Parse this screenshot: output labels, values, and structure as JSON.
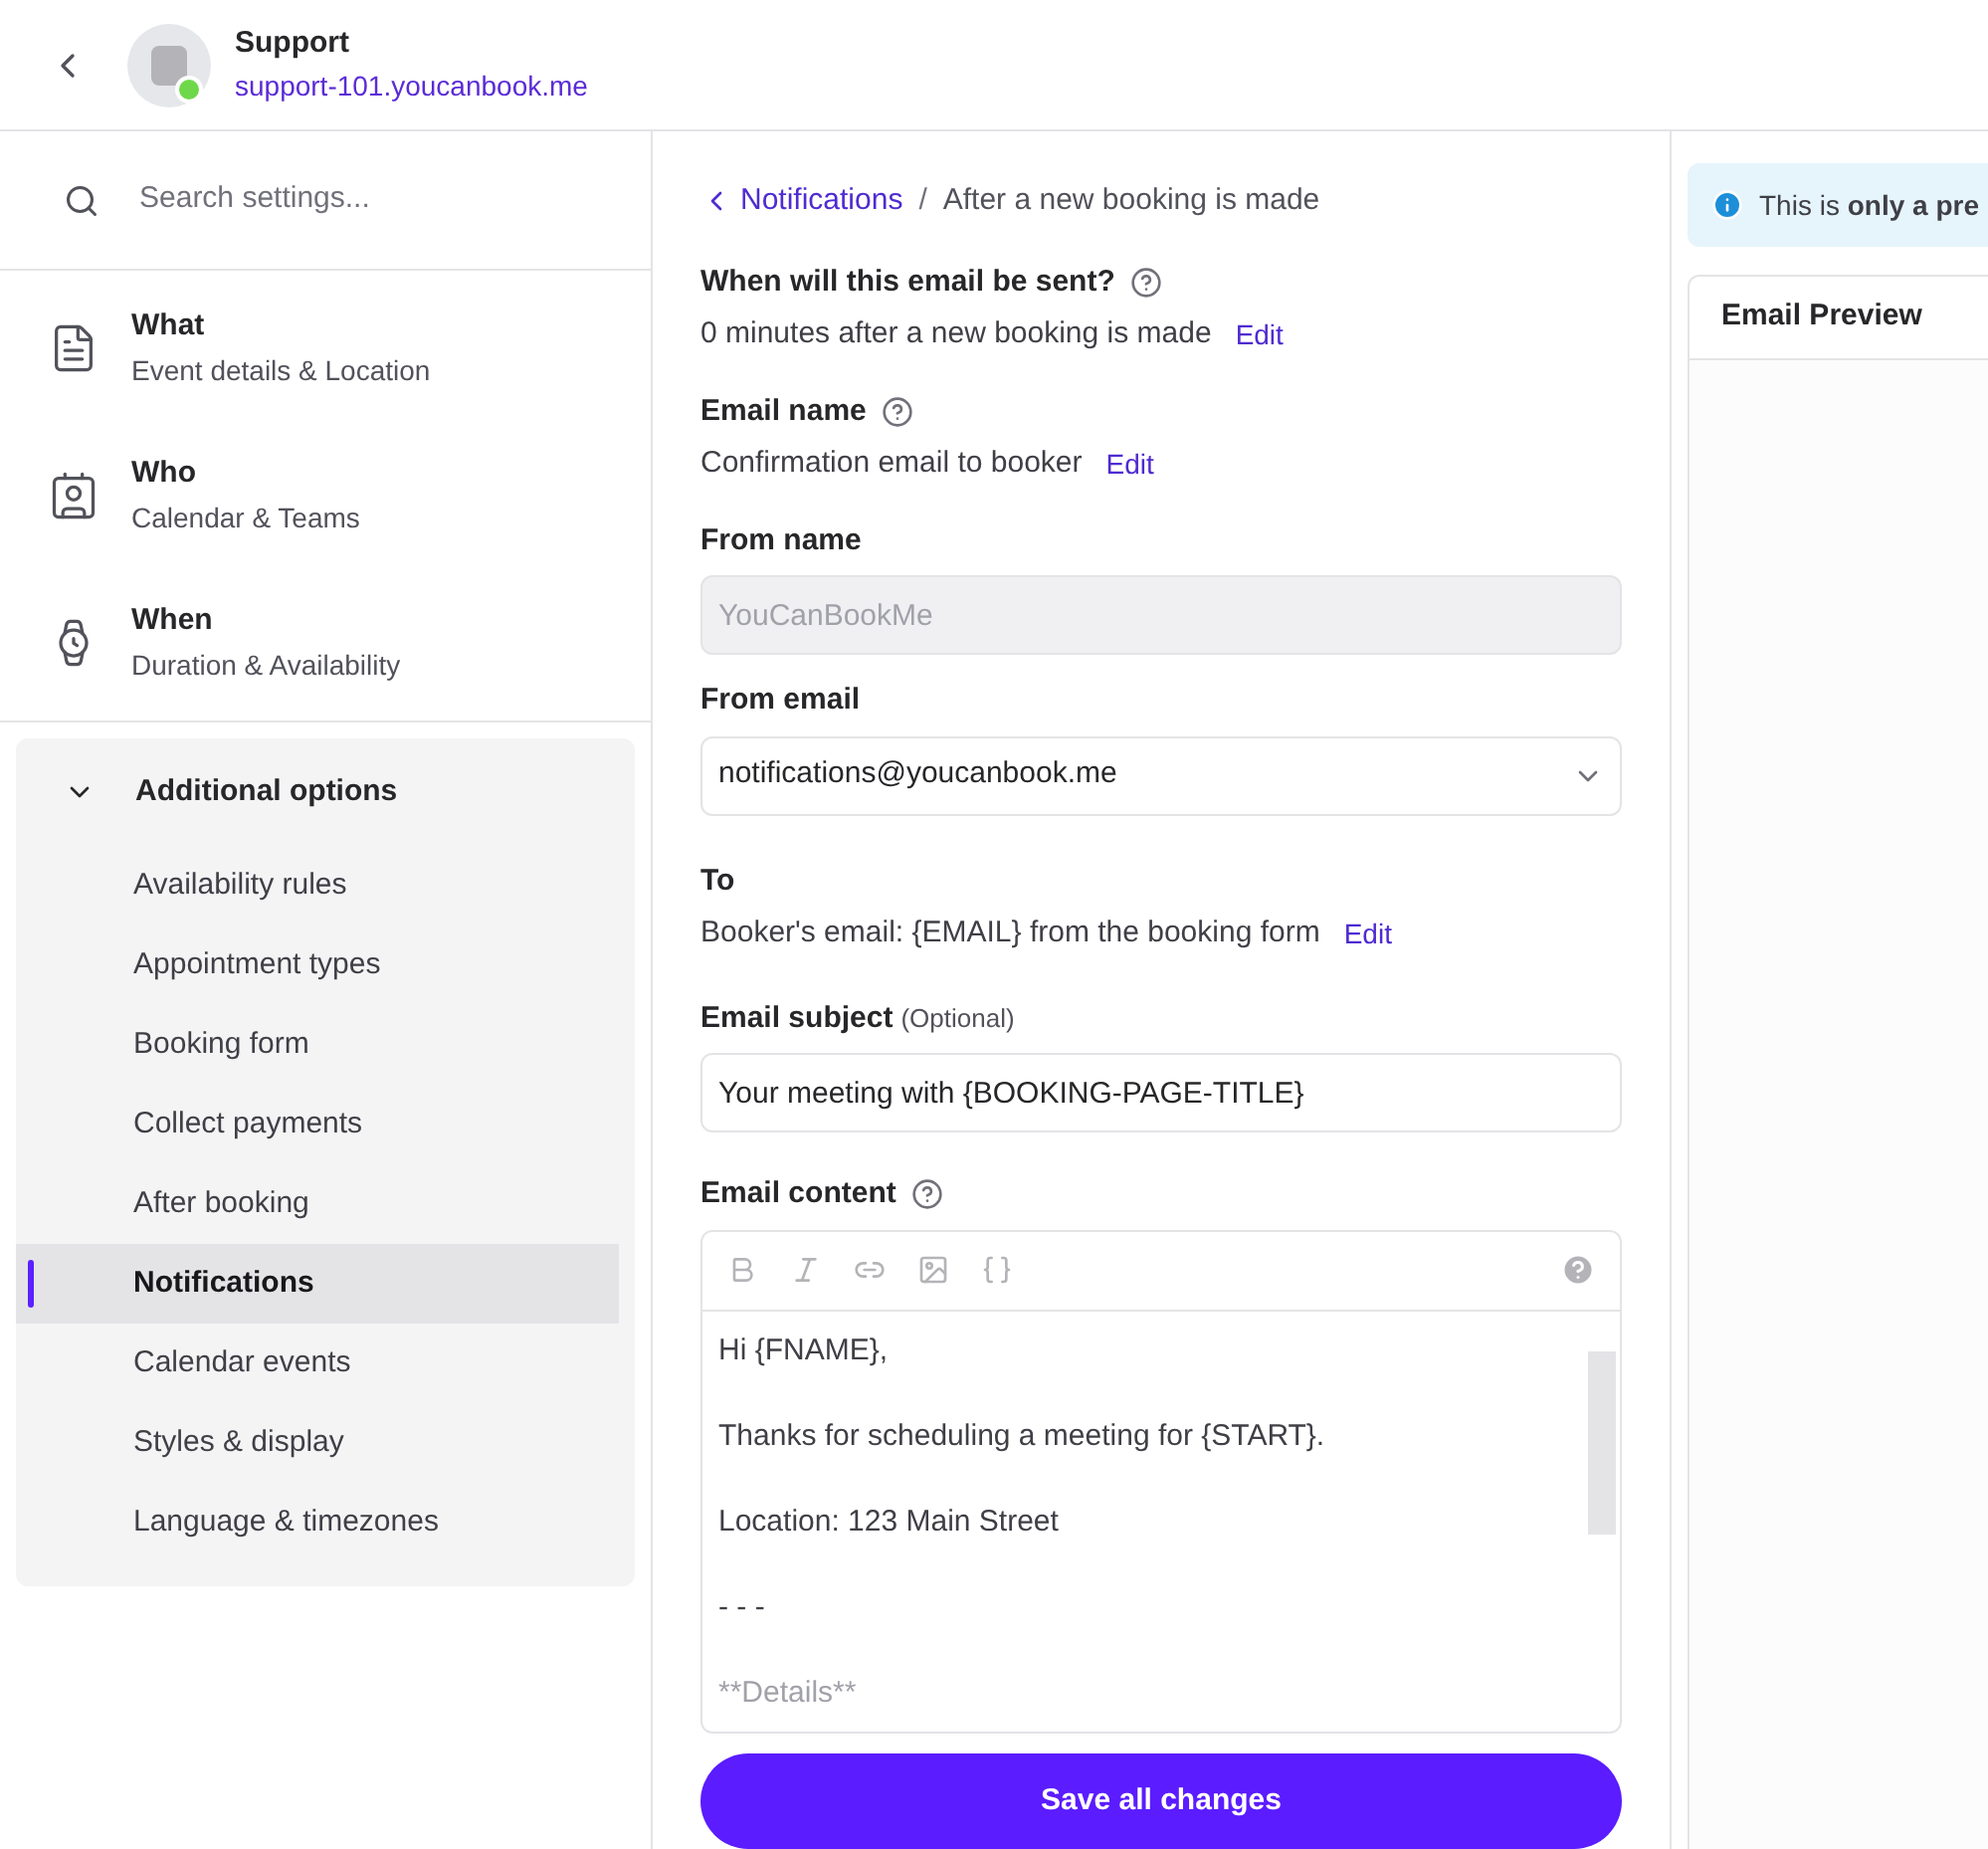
{
  "header": {
    "title": "Support",
    "subtitle": "support-101.youcanbook.me",
    "online": true
  },
  "search": {
    "placeholder": "Search settings..."
  },
  "sections": [
    {
      "kind": "details",
      "title": "What",
      "subtitle": "Event details & Location"
    },
    {
      "kind": "people",
      "title": "Who",
      "subtitle": "Calendar & Teams"
    },
    {
      "kind": "time",
      "title": "When",
      "subtitle": "Duration & Availability"
    }
  ],
  "additional": {
    "title": "Additional options",
    "expanded": true,
    "items": [
      {
        "label": "Availability rules",
        "selected": false
      },
      {
        "label": "Appointment types",
        "selected": false
      },
      {
        "label": "Booking form",
        "selected": false
      },
      {
        "label": "Collect payments",
        "selected": false
      },
      {
        "label": "After booking",
        "selected": false
      },
      {
        "label": "Notifications",
        "selected": true
      },
      {
        "label": "Calendar events",
        "selected": false
      },
      {
        "label": "Styles & display",
        "selected": false
      },
      {
        "label": "Language & timezones",
        "selected": false
      }
    ]
  },
  "breadcrumb": {
    "back": "Notifications",
    "separator": "/",
    "current": "After a new booking is made"
  },
  "when": {
    "label": "When will this email be sent?",
    "value": "0 minutes after a new booking is made",
    "edit": "Edit"
  },
  "email_name": {
    "label": "Email name",
    "value": "Confirmation email to booker",
    "edit": "Edit"
  },
  "from_name": {
    "label": "From name",
    "value": "YouCanBookMe",
    "disabled": true
  },
  "from_email": {
    "label": "From email",
    "value": "notifications@youcanbook.me"
  },
  "to": {
    "label": "To",
    "value": "Booker's email: {EMAIL} from the booking form",
    "edit": "Edit"
  },
  "subject": {
    "label": "Email subject",
    "hint": "(Optional)",
    "value": "Your meeting with {BOOKING-PAGE-TITLE}"
  },
  "content": {
    "label": "Email content",
    "lines": [
      "Hi {FNAME},",
      "Thanks for scheduling a meeting for {START}.",
      "Location: 123 Main Street",
      "- - -",
      "**Details**"
    ]
  },
  "save": "Save all changes",
  "preview": {
    "notice": "This is **only a pre**",
    "tab": "Email Preview"
  }
}
